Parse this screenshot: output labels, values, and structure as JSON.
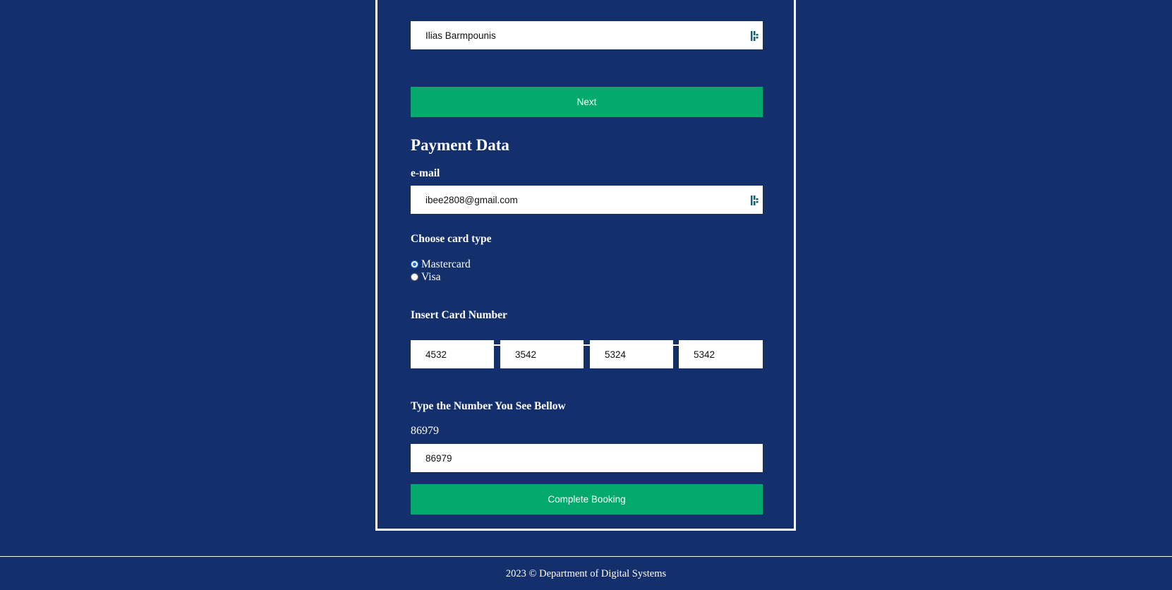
{
  "form": {
    "name_value": "Ilias Barmpounis",
    "next_label": "Next"
  },
  "payment": {
    "heading": "Payment Data",
    "email_label": "e-mail",
    "email_value": "ibee2808@gmail.com",
    "card_type_label": "Choose card type",
    "card_types": [
      {
        "label": "Mastercard",
        "checked": true
      },
      {
        "label": "Visa",
        "checked": false
      }
    ],
    "card_number_label": "Insert Card Number",
    "card_number_parts": [
      "4532",
      "3542",
      "5324",
      "5342"
    ],
    "captcha_label": "Type the Number You See Bellow",
    "captcha_number": "86979",
    "captcha_value": "86979",
    "submit_label": "Complete Booking"
  },
  "footer": {
    "text": "2023 © Department of Digital Systems"
  },
  "colors": {
    "background": "#13306d",
    "accent_button": "#04a96d",
    "field": "#ffffff",
    "text": "#ffffff"
  },
  "icons": {
    "field_icon": "password-manager-icon"
  }
}
